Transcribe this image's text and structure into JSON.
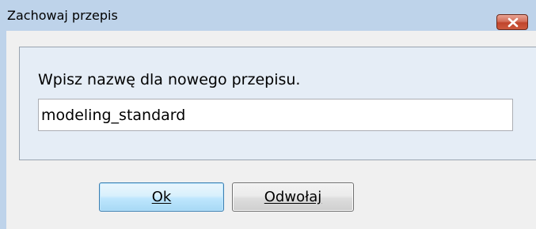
{
  "window": {
    "title": "Zachowaj przepis"
  },
  "dialog": {
    "prompt": "Wpisz nazwę dla nowego przepisu.",
    "name_input": {
      "value": "modeling_standard",
      "placeholder": ""
    }
  },
  "buttons": {
    "ok_label": "Ok",
    "cancel_label": "Odwołaj"
  },
  "icons": {
    "close": "close-icon"
  },
  "colors": {
    "title_bar": "#bed3ea",
    "panel": "#e5edf6",
    "dialog_background": "#f0f0f0",
    "close_button": "#c7513a",
    "ok_button_border": "#3c7fb1"
  }
}
